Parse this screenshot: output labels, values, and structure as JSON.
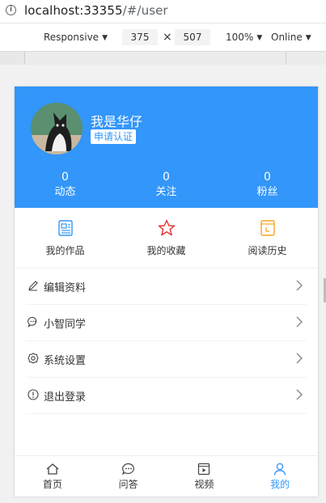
{
  "browser": {
    "url_host": "localhost:33355",
    "url_path": "/#/user"
  },
  "devtools": {
    "device": "Responsive",
    "width": "375",
    "times": "×",
    "height": "507",
    "zoom": "100%",
    "network": "Online"
  },
  "profile": {
    "name": "我是华仔",
    "verify_label": "申请认证",
    "stats": [
      {
        "value": "0",
        "label": "动态"
      },
      {
        "value": "0",
        "label": "关注"
      },
      {
        "value": "0",
        "label": "粉丝"
      }
    ]
  },
  "shortcuts": [
    {
      "label": "我的作品",
      "icon": "document-icon",
      "color": "#3296fa"
    },
    {
      "label": "我的收藏",
      "icon": "star-icon",
      "color": "#e5302e"
    },
    {
      "label": "阅读历史",
      "icon": "history-icon",
      "color": "#f5a623"
    }
  ],
  "menu": [
    {
      "label": "编辑资料",
      "icon": "pencil-icon"
    },
    {
      "label": "小智同学",
      "icon": "chat-icon"
    },
    {
      "label": "系统设置",
      "icon": "gear-icon"
    },
    {
      "label": "退出登录",
      "icon": "exit-icon"
    }
  ],
  "tabbar": [
    {
      "label": "首页",
      "icon": "home-icon"
    },
    {
      "label": "问答",
      "icon": "qa-icon"
    },
    {
      "label": "视频",
      "icon": "video-icon"
    },
    {
      "label": "我的",
      "icon": "user-icon",
      "active": true
    }
  ],
  "colors": {
    "brand": "#3296fa",
    "star": "#e5302e",
    "history": "#f5a623"
  }
}
